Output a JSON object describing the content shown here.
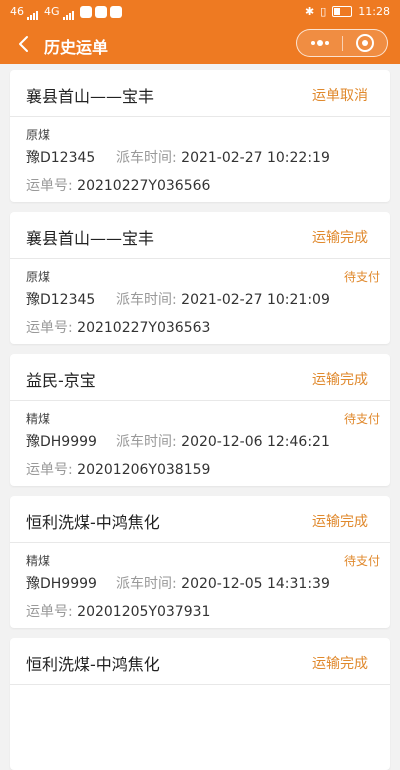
{
  "status_bar": {
    "time": "11:28",
    "carrier": "46",
    "net": "4G"
  },
  "nav": {
    "title": "历史运单"
  },
  "labels": {
    "dispatch_time": "派车时间:",
    "waybill_no": "运单号:"
  },
  "orders": [
    {
      "route": "襄县首山——宝丰",
      "status": "运单取消",
      "goods": "原煤",
      "payment": "",
      "plate": "豫D12345",
      "dispatch_time": "2021-02-27 10:22:19",
      "waybill_no": "20210227Y036566"
    },
    {
      "route": "襄县首山——宝丰",
      "status": "运输完成",
      "goods": "原煤",
      "payment": "待支付",
      "plate": "豫D12345",
      "dispatch_time": "2021-02-27 10:21:09",
      "waybill_no": "20210227Y036563"
    },
    {
      "route": "益民-京宝",
      "status": "运输完成",
      "goods": "精煤",
      "payment": "待支付",
      "plate": "豫DH9999",
      "dispatch_time": "2020-12-06 12:46:21",
      "waybill_no": "20201206Y038159"
    },
    {
      "route": "恒利洗煤-中鸿焦化",
      "status": "运输完成",
      "goods": "精煤",
      "payment": "待支付",
      "plate": "豫DH9999",
      "dispatch_time": "2020-12-05 14:31:39",
      "waybill_no": "20201205Y037931"
    },
    {
      "route": "恒利洗煤-中鸿焦化",
      "status": "运输完成"
    }
  ],
  "colors": {
    "brand": "#ee7a22",
    "status_text": "#e0892d",
    "background": "#f2f2f2"
  }
}
